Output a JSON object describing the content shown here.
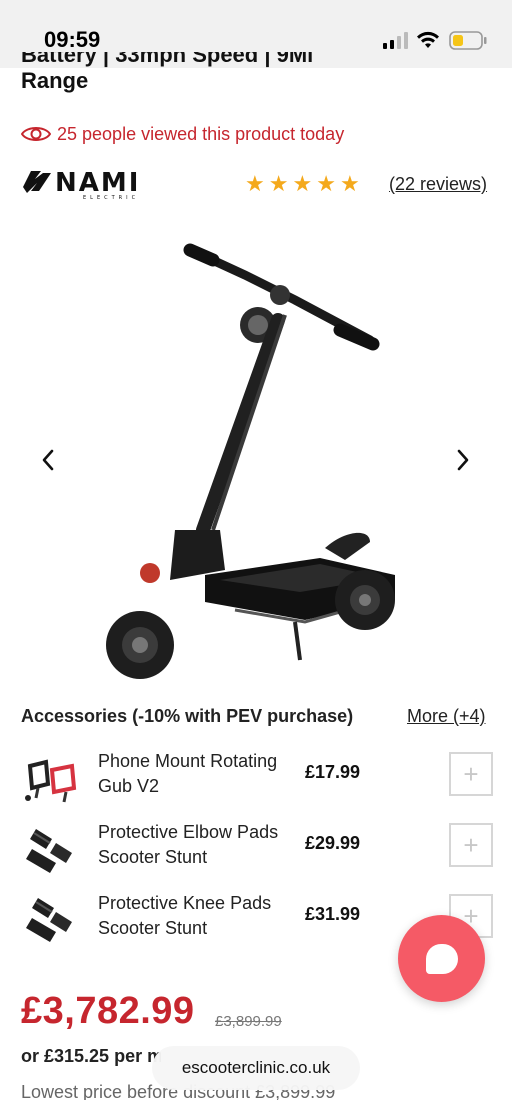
{
  "status": {
    "time": "09:59"
  },
  "product": {
    "title_line1": "Battery | 33mph Speed | 9Mi",
    "title_line2": "Range",
    "viewed_text": "25 people viewed this product today",
    "rating_stars": 5,
    "reviews_text": "(22 reviews)",
    "brand_name": "NAMI",
    "brand_sub": "ELECTRIC"
  },
  "accessories": {
    "header": "Accessories (-10% with PEV purchase)",
    "more_label": "More (+4)",
    "items": [
      {
        "name": "Phone Mount Rotating Gub V2",
        "price": "£17.99",
        "add_label": "+"
      },
      {
        "name": "Protective Elbow Pads Scooter Stunt",
        "price": "£29.99",
        "add_label": "+"
      },
      {
        "name": "Protective Knee Pads Scooter Stunt",
        "price": "£31.99",
        "add_label": "+"
      }
    ]
  },
  "pricing": {
    "price": "£3,782.99",
    "old_price": "£3,899.99",
    "per_month": "or £315.25 per m",
    "lowest_price": "Lowest price before discount £3,899.99"
  },
  "browser": {
    "url": "escooterclinic.co.uk"
  },
  "colors": {
    "accent_red": "#c6262e",
    "star_gold": "#f4a91c",
    "chat_pink": "#f55a66"
  }
}
